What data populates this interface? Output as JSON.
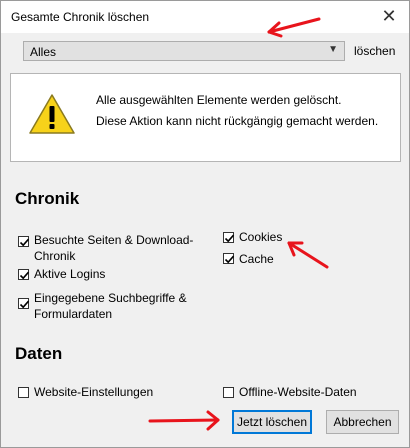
{
  "window": {
    "title": "Gesamte Chronik löschen"
  },
  "range": {
    "selected": "Alles",
    "suffix": "löschen"
  },
  "warning": {
    "line1": "Alle ausgewählten Elemente werden gelöscht.",
    "line2": "Diese Aktion kann nicht rückgängig gemacht werden."
  },
  "history": {
    "title": "Chronik",
    "items": [
      {
        "label": "Besuchte Seiten & Download-Chronik",
        "checked": true
      },
      {
        "label": "Aktive Logins",
        "checked": true
      },
      {
        "label": "Eingegebene Suchbegriffe & Formulardaten",
        "checked": true
      },
      {
        "label": "Cookies",
        "checked": true
      },
      {
        "label": "Cache",
        "checked": true
      }
    ]
  },
  "data": {
    "title": "Daten",
    "items": [
      {
        "label": "Website-Einstellungen",
        "checked": false
      },
      {
        "label": "Offline-Website-Daten",
        "checked": false
      }
    ]
  },
  "buttons": {
    "clear": "Jetzt löschen",
    "cancel": "Abbrechen"
  },
  "colors": {
    "accent": "#0078d7",
    "annotation": "#e8141c",
    "warning": "#f7d21a"
  }
}
